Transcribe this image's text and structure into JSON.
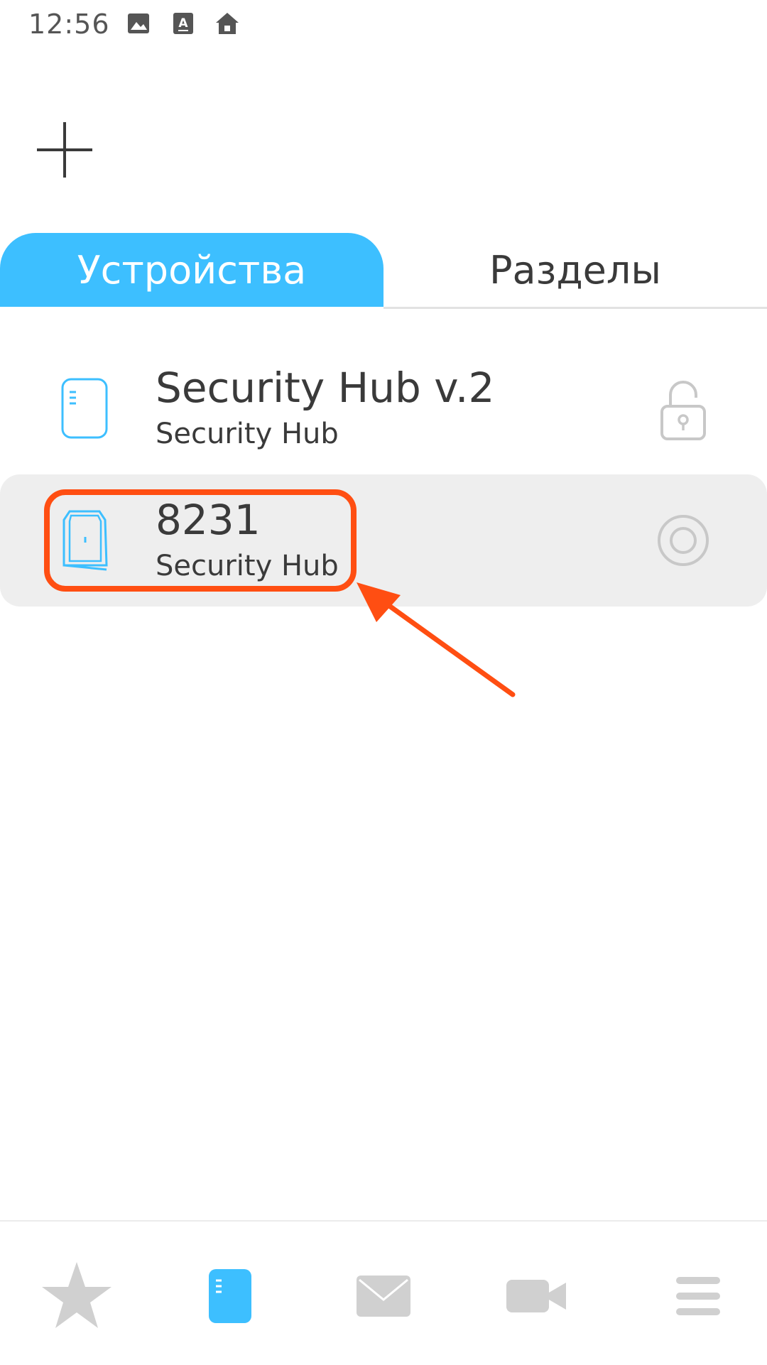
{
  "status_bar": {
    "time": "12:56",
    "icons": [
      "image-icon",
      "keyboard-a-icon",
      "home-icon"
    ]
  },
  "toolbar": {
    "add_icon": "plus-icon"
  },
  "tabs": [
    {
      "label": "Устройства",
      "active": true
    },
    {
      "label": "Разделы",
      "active": false
    }
  ],
  "devices": [
    {
      "name": "Security Hub v.2",
      "type": "Security Hub",
      "device_icon": "hub-icon",
      "status_icon": "unlock-icon",
      "highlighted": false
    },
    {
      "name": "8231",
      "type": "Security Hub",
      "device_icon": "hub-v1-icon",
      "status_icon": "ring-icon",
      "highlighted": true
    }
  ],
  "bottom_nav": [
    {
      "icon": "star-icon",
      "active": false
    },
    {
      "icon": "device-icon",
      "active": true
    },
    {
      "icon": "mail-icon",
      "active": false
    },
    {
      "icon": "camera-icon",
      "active": false
    },
    {
      "icon": "menu-icon",
      "active": false
    }
  ],
  "colors": {
    "accent": "#3dbfff",
    "annotation": "#ff4e12",
    "inactive_icon": "#d0d0d0",
    "row_highlight": "#eeeeee"
  }
}
